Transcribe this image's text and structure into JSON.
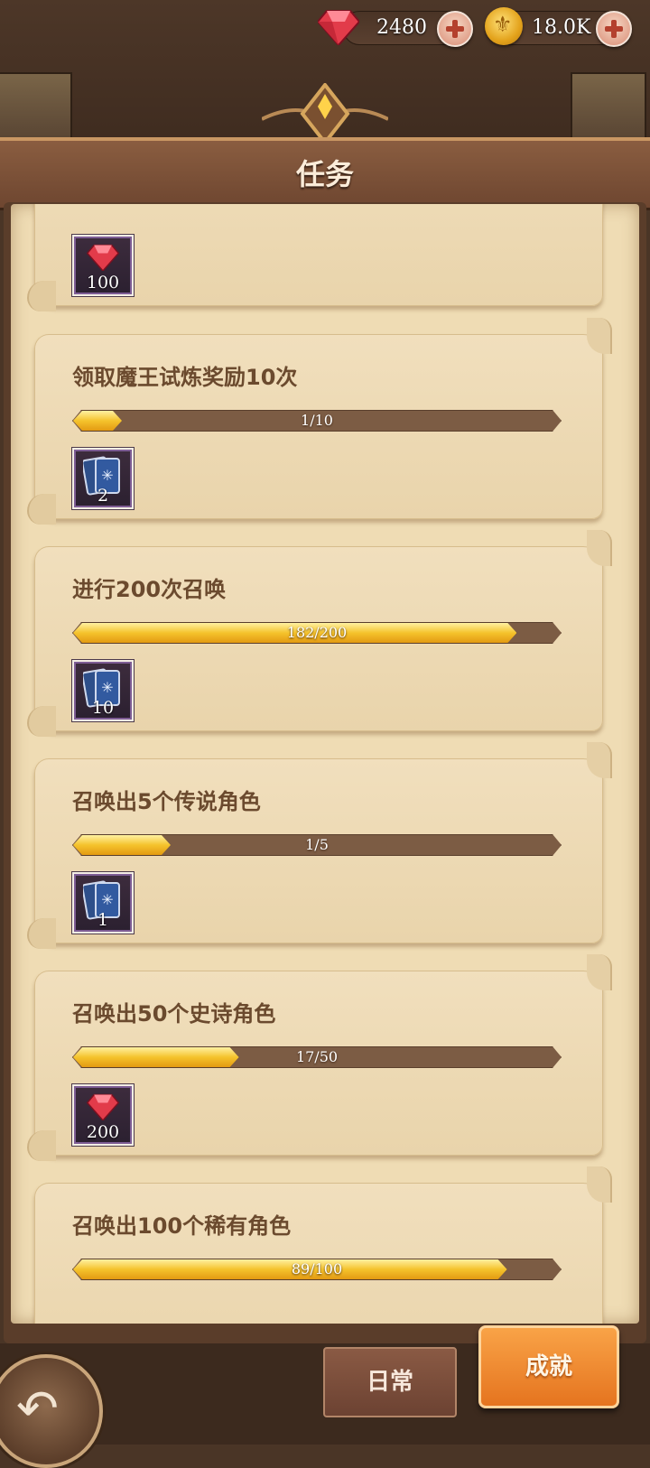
{
  "currency": {
    "gems": "2480",
    "gold": "18.0K"
  },
  "header": {
    "title": "任务"
  },
  "tasks": [
    {
      "title": "",
      "progress_text": "",
      "progress": null,
      "reward_type": "gem-icon",
      "reward_count": "100"
    },
    {
      "title": "领取魔王试炼奖励10次",
      "progress_text": "1/10",
      "progress": 0.1,
      "reward_type": "summon-card-icon",
      "reward_count": "2"
    },
    {
      "title": "进行200次召唤",
      "progress_text": "182/200",
      "progress": 0.91,
      "reward_type": "summon-card-icon",
      "reward_count": "10"
    },
    {
      "title": "召唤出5个传说角色",
      "progress_text": "1/5",
      "progress": 0.2,
      "reward_type": "summon-card-icon",
      "reward_count": "1"
    },
    {
      "title": "召唤出50个史诗角色",
      "progress_text": "17/50",
      "progress": 0.34,
      "reward_type": "gem-icon",
      "reward_count": "200"
    },
    {
      "title": "召唤出100个稀有角色",
      "progress_text": "89/100",
      "progress": 0.89,
      "reward_type": "",
      "reward_count": ""
    }
  ],
  "tabs": {
    "daily": "日常",
    "achievement": "成就"
  },
  "colors": {
    "accent": "#e5741f",
    "progress_fill": "#f5c32c",
    "parchment": "#efdcb4"
  }
}
